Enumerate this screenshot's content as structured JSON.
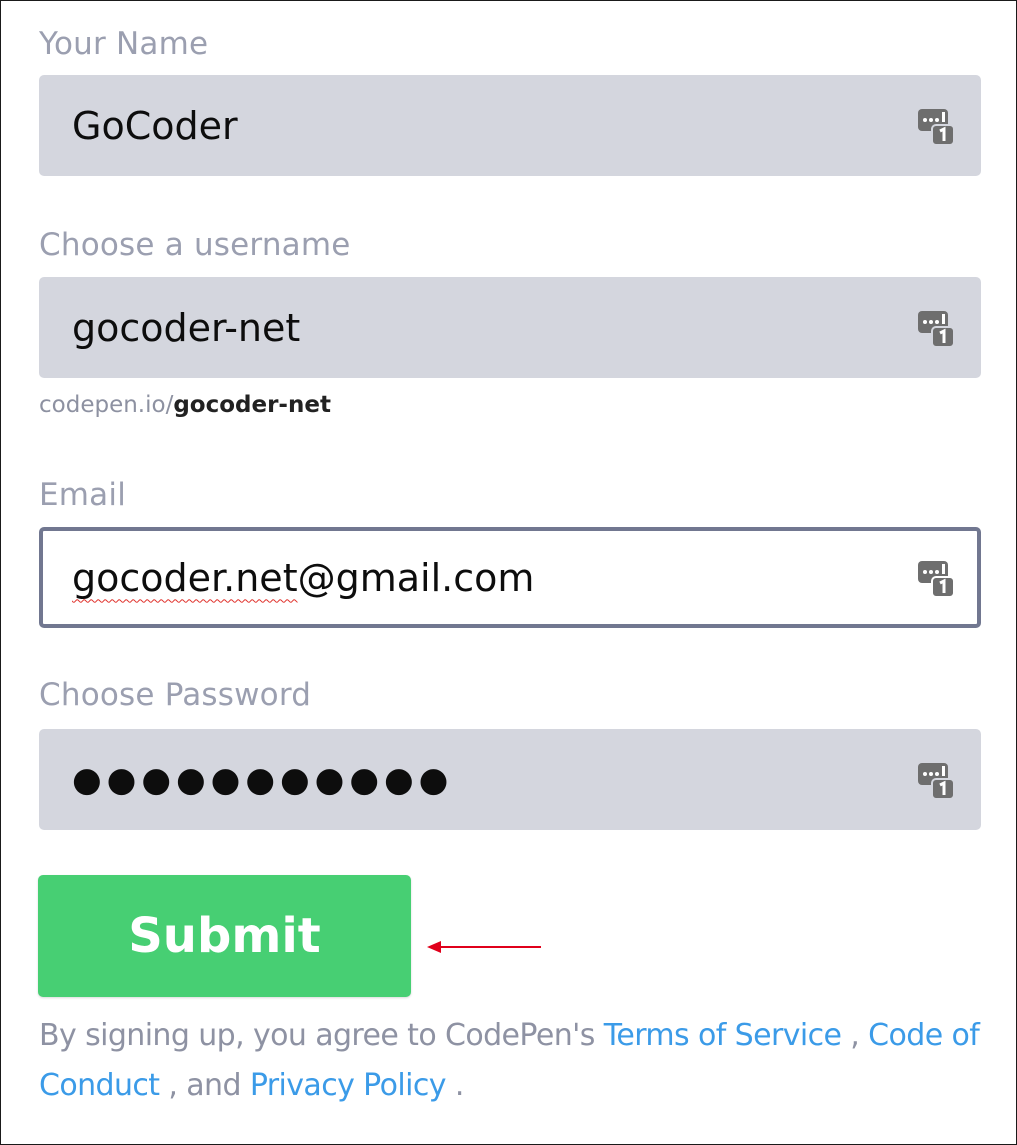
{
  "form": {
    "name": {
      "label": "Your Name",
      "value": "GoCoder",
      "icon": "password-manager-icon"
    },
    "username": {
      "label": "Choose a username",
      "value": "gocoder-net",
      "icon": "password-manager-icon",
      "url_prefix": "codepen.io/",
      "url_username": "gocoder-net"
    },
    "email": {
      "label": "Email",
      "value": "gocoder.net@gmail.com",
      "value_underlined": "gocoder.net",
      "value_rest": "@gmail.com",
      "icon": "password-manager-icon",
      "focused": true
    },
    "password": {
      "label": "Choose Password",
      "masked_value": "●●●●●●●●●●●",
      "icon": "password-manager-icon"
    },
    "submit_label": "Submit"
  },
  "annotation": {
    "arrow_color": "#e0001b",
    "points_to": "submit-button"
  },
  "agreement": {
    "prefix": "By signing up, you agree to CodePen's ",
    "terms_link": "Terms of Service",
    "separator_1": " , ",
    "conduct_link": "Code of Conduct",
    "separator_2": " , and ",
    "privacy_link": "Privacy Policy",
    "suffix": " ."
  },
  "colors": {
    "label": "#9b9fb0",
    "field_bg": "#d4d6de",
    "focus_border": "#717790",
    "submit_bg": "#47cf73",
    "link": "#3b9be8"
  }
}
